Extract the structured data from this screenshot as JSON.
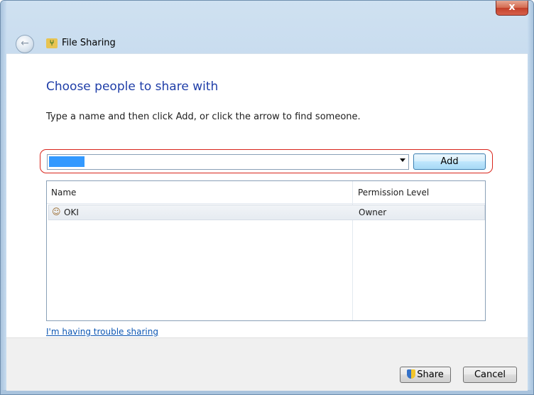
{
  "window": {
    "title": "File Sharing",
    "close_label": "x"
  },
  "main": {
    "heading": "Choose people to share with",
    "instruction": "Type a name and then click Add, or click the arrow to find someone.",
    "name_input": {
      "value": ""
    },
    "add_label": "Add",
    "list": {
      "columns": [
        "Name",
        "Permission Level"
      ],
      "rows": [
        {
          "name": "OKI",
          "permission": "Owner"
        }
      ]
    },
    "trouble_link": "I'm having trouble sharing"
  },
  "footer": {
    "share_label": "Share",
    "cancel_label": "Cancel"
  },
  "colors": {
    "heading": "#1f3ea8",
    "highlight_ring": "#d9251c",
    "link": "#0c56b3"
  }
}
